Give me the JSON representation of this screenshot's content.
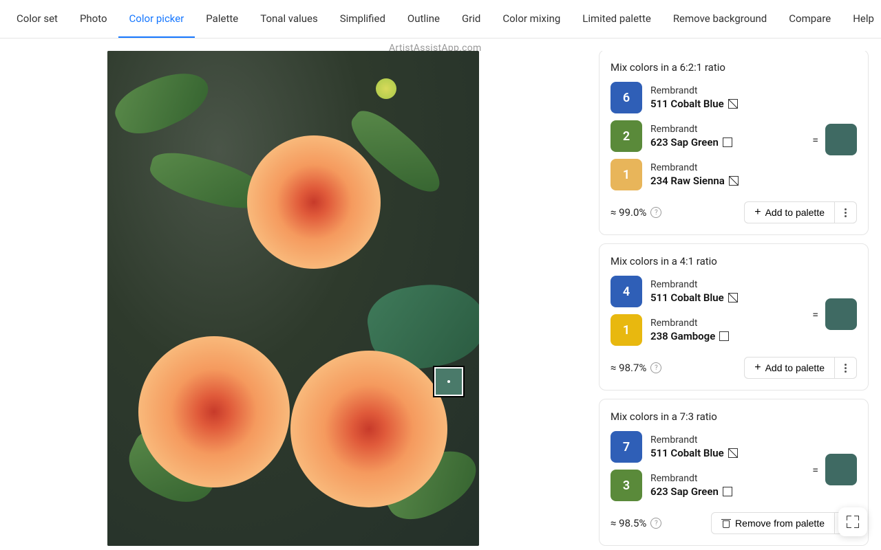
{
  "watermark": "ArtistAssistApp.com",
  "tabs": [
    {
      "label": "Color set",
      "active": false
    },
    {
      "label": "Photo",
      "active": false
    },
    {
      "label": "Color picker",
      "active": true
    },
    {
      "label": "Palette",
      "active": false
    },
    {
      "label": "Tonal values",
      "active": false
    },
    {
      "label": "Simplified",
      "active": false
    },
    {
      "label": "Outline",
      "active": false
    },
    {
      "label": "Grid",
      "active": false
    },
    {
      "label": "Color mixing",
      "active": false
    },
    {
      "label": "Limited palette",
      "active": false
    },
    {
      "label": "Remove background",
      "active": false
    },
    {
      "label": "Compare",
      "active": false
    },
    {
      "label": "Help",
      "active": false
    }
  ],
  "add_label": "Add to palette",
  "remove_label": "Remove from palette",
  "picked_color": "#3f6a63",
  "mixes": [
    {
      "title": "Mix colors in a 6:2:1 ratio",
      "accuracy": "≈ 99.0%",
      "result": "#3f6a63",
      "action": "add",
      "parts": [
        {
          "ratio": "6",
          "bg": "#2f5fb7",
          "brand": "Rembrandt",
          "name": "511 Cobalt Blue",
          "trans": "diag"
        },
        {
          "ratio": "2",
          "bg": "#5a8a3a",
          "brand": "Rembrandt",
          "name": "623 Sap Green",
          "trans": "open"
        },
        {
          "ratio": "1",
          "bg": "#e8b55a",
          "brand": "Rembrandt",
          "name": "234 Raw Sienna",
          "trans": "diag"
        }
      ]
    },
    {
      "title": "Mix colors in a 4:1 ratio",
      "accuracy": "≈ 98.7%",
      "result": "#3f6a63",
      "action": "add",
      "parts": [
        {
          "ratio": "4",
          "bg": "#2f5fb7",
          "brand": "Rembrandt",
          "name": "511 Cobalt Blue",
          "trans": "diag"
        },
        {
          "ratio": "1",
          "bg": "#e8b80f",
          "brand": "Rembrandt",
          "name": "238 Gamboge",
          "trans": "open"
        }
      ]
    },
    {
      "title": "Mix colors in a 7:3 ratio",
      "accuracy": "≈ 98.5%",
      "result": "#3f6a63",
      "action": "remove",
      "parts": [
        {
          "ratio": "7",
          "bg": "#2f5fb7",
          "brand": "Rembrandt",
          "name": "511 Cobalt Blue",
          "trans": "diag"
        },
        {
          "ratio": "3",
          "bg": "#5a8a3a",
          "brand": "Rembrandt",
          "name": "623 Sap Green",
          "trans": "open"
        }
      ]
    }
  ]
}
